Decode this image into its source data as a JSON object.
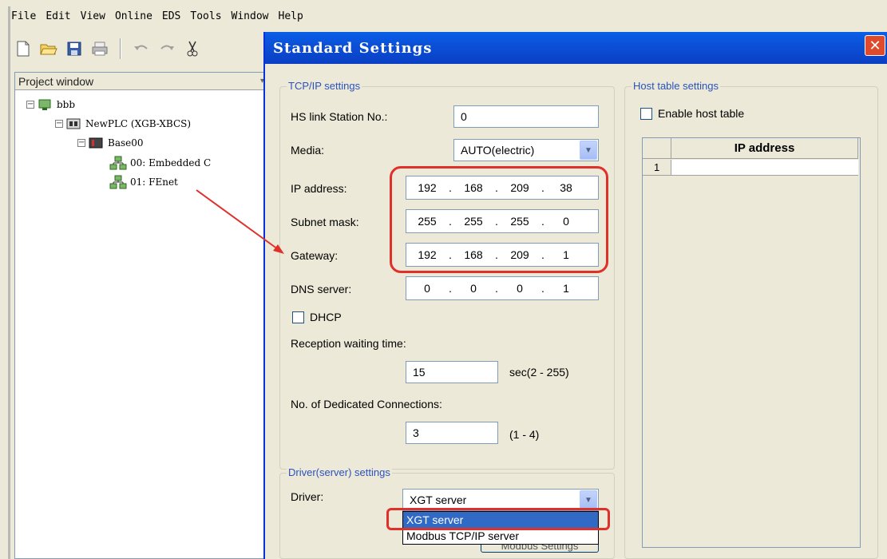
{
  "menu": {
    "items": [
      "File",
      "Edit",
      "View",
      "Online",
      "EDS",
      "Tools",
      "Window",
      "Help"
    ]
  },
  "toolbar": {
    "icons": [
      "new-file-icon",
      "open-folder-icon",
      "save-icon",
      "print-icon",
      "undo-icon",
      "redo-icon",
      "cut-icon"
    ]
  },
  "project_window": {
    "title": "Project window",
    "tree": {
      "root": "bbb",
      "plc": "NewPLC (XGB-XBCS)",
      "base": "Base00",
      "module0": "00: Embedded C",
      "module1": "01: FEnet"
    }
  },
  "dialog": {
    "title": "Standard Settings",
    "tcpip": {
      "legend": "TCP/IP settings",
      "hs_label": "HS link Station No.:",
      "hs_value": "0",
      "media_label": "Media:",
      "media_value": "AUTO(electric)",
      "ip_label": "IP address:",
      "ip": [
        "192",
        "168",
        "209",
        "38"
      ],
      "subnet_label": "Subnet mask:",
      "subnet": [
        "255",
        "255",
        "255",
        "0"
      ],
      "gateway_label": "Gateway:",
      "gateway": [
        "192",
        "168",
        "209",
        "1"
      ],
      "dns_label": "DNS server:",
      "dns": [
        "0",
        "0",
        "0",
        "1"
      ],
      "dhcp_label": "DHCP",
      "reception_label": "Reception waiting time:",
      "reception_value": "15",
      "reception_range": "sec(2 - 255)",
      "dedicated_label": "No. of Dedicated Connections:",
      "dedicated_value": "3",
      "dedicated_range": "(1 - 4)"
    },
    "driver": {
      "legend": "Driver(server) settings",
      "driver_label": "Driver:",
      "driver_value": "XGT server",
      "options": [
        "XGT server",
        "Modbus TCP/IP server"
      ],
      "partial_button": "Modbus Settings"
    },
    "host": {
      "legend": "Host table settings",
      "enable_label": "Enable host table",
      "column_header": "IP address",
      "row_number": "1"
    }
  },
  "colors": {
    "highlight": "#e0302a",
    "titlebar": "#0b4fd6",
    "selection": "#316ac5"
  }
}
